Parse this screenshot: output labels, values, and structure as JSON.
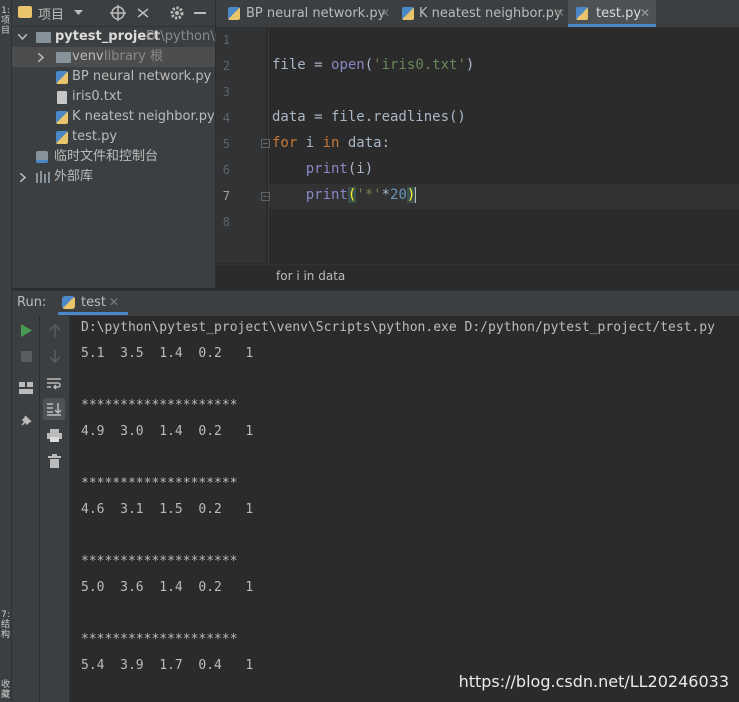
{
  "left_strip": {
    "top_label": "1: 项目",
    "bottom_label_1": "7: 结构",
    "bottom_label_2": "收藏"
  },
  "project_panel": {
    "header_label": "项目",
    "root": {
      "name": "pytest_project",
      "path": "D:\\python\\p"
    },
    "items": [
      {
        "label": "venv",
        "suffix": "library 根"
      },
      {
        "label": "BP neural network.py"
      },
      {
        "label": "iris0.txt"
      },
      {
        "label": "K neatest neighbor.py"
      },
      {
        "label": "test.py"
      },
      {
        "label": "临时文件和控制台"
      },
      {
        "label": "外部库"
      }
    ]
  },
  "editor": {
    "tabs": [
      {
        "label": "BP neural network.py"
      },
      {
        "label": "K neatest neighbor.py"
      },
      {
        "label": "test.py",
        "active": true
      }
    ],
    "line_numbers": [
      "1",
      "2",
      "3",
      "4",
      "5",
      "6",
      "7",
      "8"
    ],
    "code": {
      "l2_a": "file = ",
      "l2_b": "open",
      "l2_c": "(",
      "l2_d": "'iris0.txt'",
      "l2_e": ")",
      "l4": "data = file.readlines()",
      "l5_kw1": "for",
      "l5_a": " i ",
      "l5_kw2": "in",
      "l5_b": " data:",
      "l6_a": "    ",
      "l6_fn": "print",
      "l6_b": "(i)",
      "l7_a": "    ",
      "l7_fn": "print",
      "l7_b": "(",
      "l7_str": "'*'",
      "l7_c": "*",
      "l7_num": "20",
      "l7_d": ")"
    },
    "breadcrumb": "for i in data"
  },
  "run_panel": {
    "label": "Run:",
    "tab_label": "test",
    "console_lines": [
      "D:\\python\\pytest_project\\venv\\Scripts\\python.exe D:/python/pytest_project/test.py",
      "5.1  3.5  1.4  0.2   1",
      "",
      "********************",
      "4.9  3.0  1.4  0.2   1",
      "",
      "********************",
      "4.6  3.1  1.5  0.2   1",
      "",
      "********************",
      "5.0  3.6  1.4  0.2   1",
      "",
      "********************",
      "5.4  3.9  1.7  0.4   1"
    ]
  },
  "watermark": "https://blog.csdn.net/LL20246033",
  "colors": {
    "keyword": "#cc7832",
    "string": "#6a8759",
    "number": "#6897bb",
    "builtin": "#8888c6",
    "run_green": "#499c54",
    "tab_underline": "#4a88c7"
  }
}
